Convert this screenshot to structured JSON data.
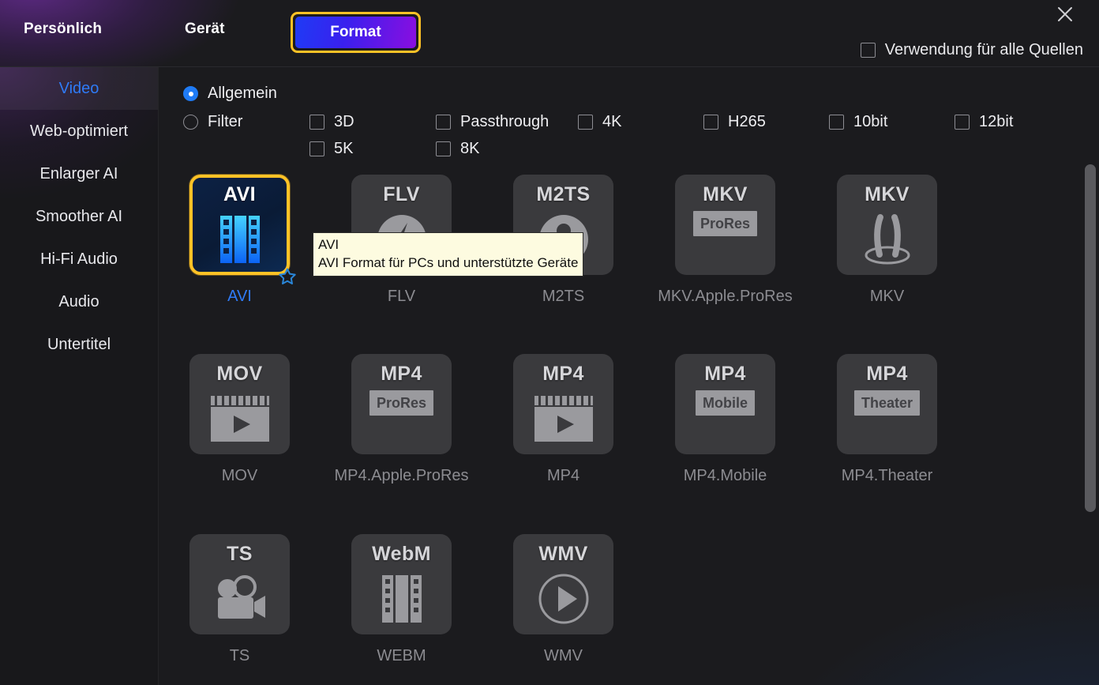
{
  "window": {
    "close_icon": "close-icon"
  },
  "header": {
    "tabs": [
      {
        "label": "Persönlich",
        "active": false
      },
      {
        "label": "Gerät",
        "active": false
      },
      {
        "label": "Format",
        "active": true
      }
    ],
    "all_sources": {
      "label": "Verwendung für alle Quellen",
      "checked": false
    },
    "accent_yellow": "#ffc226",
    "accent_blue": "#2f7bf6"
  },
  "sidebar": {
    "items": [
      {
        "label": "Video",
        "active": true
      },
      {
        "label": "Web-optimiert",
        "active": false
      },
      {
        "label": "Enlarger AI",
        "active": false
      },
      {
        "label": "Smoother AI",
        "active": false
      },
      {
        "label": "Hi-Fi Audio",
        "active": false
      },
      {
        "label": "Audio",
        "active": false
      },
      {
        "label": "Untertitel",
        "active": false
      }
    ]
  },
  "options": {
    "radios": [
      {
        "label": "Allgemein",
        "checked": true
      },
      {
        "label": "Filter",
        "checked": false
      }
    ],
    "checkboxes": [
      {
        "label": "3D",
        "checked": false
      },
      {
        "label": "Passthrough",
        "checked": false
      },
      {
        "label": "4K",
        "checked": false
      },
      {
        "label": "H265",
        "checked": false
      },
      {
        "label": "10bit",
        "checked": false
      },
      {
        "label": "12bit",
        "checked": false
      },
      {
        "label": "5K",
        "checked": false
      },
      {
        "label": "8K",
        "checked": false
      }
    ]
  },
  "formats": [
    {
      "label": "AVI",
      "code": "AVI",
      "sub": "",
      "glyph": "film-strip-icon",
      "selected": true,
      "favorite": true
    },
    {
      "label": "FLV",
      "code": "FLV",
      "sub": "",
      "glyph": "flash-play-icon",
      "selected": false,
      "favorite": false
    },
    {
      "label": "M2TS",
      "code": "M2TS",
      "sub": "",
      "glyph": "disc-person-icon",
      "selected": false,
      "favorite": false
    },
    {
      "label": "MKV.Apple.ProRes",
      "code": "MKV",
      "sub": "ProRes",
      "glyph": "sub-box-icon",
      "selected": false,
      "favorite": false
    },
    {
      "label": "MKV",
      "code": "MKV",
      "sub": "",
      "glyph": "matroska-icon",
      "selected": false,
      "favorite": false
    },
    {
      "label": "MOV",
      "code": "MOV",
      "sub": "",
      "glyph": "clapper-play-icon",
      "selected": false,
      "favorite": false
    },
    {
      "label": "MP4.Apple.ProRes",
      "code": "MP4",
      "sub": "ProRes",
      "glyph": "sub-box-icon",
      "selected": false,
      "favorite": false
    },
    {
      "label": "MP4",
      "code": "MP4",
      "sub": "",
      "glyph": "clapper-play-icon",
      "selected": false,
      "favorite": false
    },
    {
      "label": "MP4.Mobile",
      "code": "MP4",
      "sub": "Mobile",
      "glyph": "sub-box-icon",
      "selected": false,
      "favorite": false
    },
    {
      "label": "MP4.Theater",
      "code": "MP4",
      "sub": "Theater",
      "glyph": "sub-box-icon",
      "selected": false,
      "favorite": false
    },
    {
      "label": "TS",
      "code": "TS",
      "sub": "",
      "glyph": "camcorder-icon",
      "selected": false,
      "favorite": false
    },
    {
      "label": "WEBM",
      "code": "WebM",
      "sub": "",
      "glyph": "film-reel-icon",
      "selected": false,
      "favorite": false
    },
    {
      "label": "WMV",
      "code": "WMV",
      "sub": "",
      "glyph": "play-circle-icon",
      "selected": false,
      "favorite": false
    }
  ],
  "tooltip": {
    "title": "AVI",
    "description": "AVI Format für PCs und unterstützte Geräte"
  }
}
